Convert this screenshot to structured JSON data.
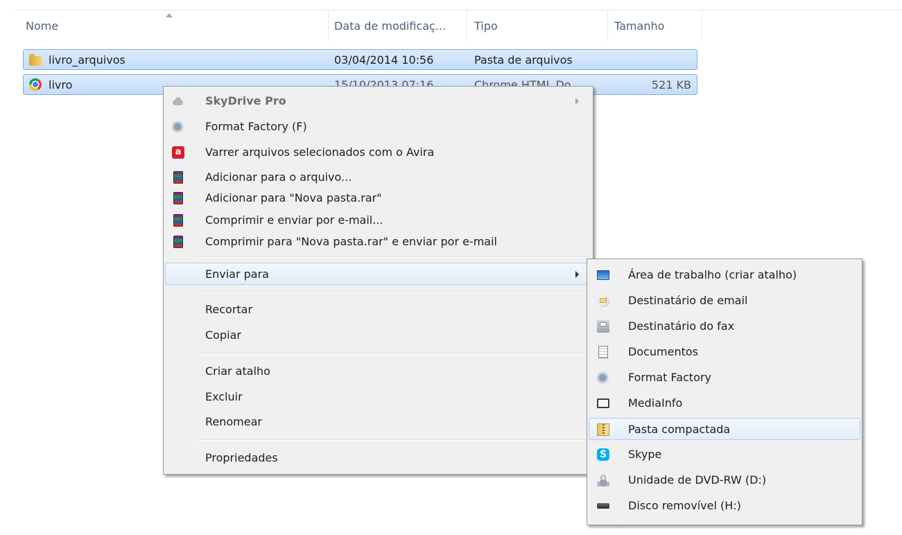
{
  "columns": {
    "name": "Nome",
    "date": "Data de modificaç...",
    "type": "Tipo",
    "size": "Tamanho"
  },
  "files": [
    {
      "icon": "folder-icon",
      "name": "livro_arquivos",
      "date": "03/04/2014 10:56",
      "type": "Pasta de arquivos",
      "size": ""
    },
    {
      "icon": "chrome-icon",
      "name": "livro",
      "date": "15/10/2013 07:16",
      "type": "Chrome HTML Do...",
      "size": "521 KB"
    }
  ],
  "context_menu": {
    "items": [
      {
        "label": "SkyDrive Pro",
        "icon": "cloud-icon",
        "disabled": true,
        "submenu": true
      },
      {
        "label": "Format Factory (F)",
        "icon": "format-factory-icon"
      },
      {
        "label": "Varrer arquivos selecionados com o Avira",
        "icon": "avira-icon"
      },
      {
        "label": "Adicionar para o arquivo...",
        "icon": "winrar-icon"
      },
      {
        "label": "Adicionar para \"Nova pasta.rar\"",
        "icon": "winrar-icon"
      },
      {
        "label": "Comprimir e enviar por e-mail...",
        "icon": "winrar-icon"
      },
      {
        "label": "Comprimir para \"Nova pasta.rar\" e enviar por e-mail",
        "icon": "winrar-icon"
      },
      {
        "label": "Enviar para",
        "submenu": true,
        "highlighted": true
      },
      {
        "label": "Recortar"
      },
      {
        "label": "Copiar"
      },
      {
        "label": "Criar atalho"
      },
      {
        "label": "Excluir"
      },
      {
        "label": "Renomear"
      },
      {
        "label": "Propriedades"
      }
    ]
  },
  "send_to_menu": {
    "items": [
      {
        "label": "Área de trabalho (criar atalho)",
        "icon": "desktop-icon"
      },
      {
        "label": "Destinatário de email",
        "icon": "mail-icon"
      },
      {
        "label": "Destinatário do fax",
        "icon": "fax-icon"
      },
      {
        "label": "Documentos",
        "icon": "documents-icon"
      },
      {
        "label": "Format Factory",
        "icon": "format-factory-icon"
      },
      {
        "label": "MediaInfo",
        "icon": "mediainfo-icon"
      },
      {
        "label": "Pasta compactada",
        "icon": "zip-folder-icon",
        "highlighted": true
      },
      {
        "label": "Skype",
        "icon": "skype-icon"
      },
      {
        "label": "Unidade de DVD-RW (D:)",
        "icon": "dvd-drive-icon"
      },
      {
        "label": "Disco removível (H:)",
        "icon": "removable-disk-icon"
      }
    ]
  }
}
